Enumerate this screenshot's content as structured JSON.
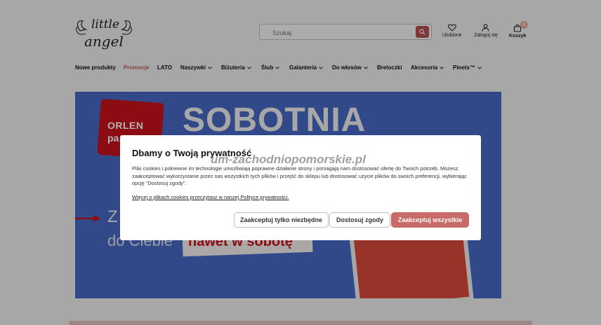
{
  "header": {
    "logo_text_top": "little",
    "logo_text_bottom": "angel",
    "search_placeholder": "Szukaj",
    "favorites_label": "Ulubione",
    "login_label": "Zaloguj się",
    "cart_label": "Koszyk",
    "cart_count": "0"
  },
  "nav": {
    "items": [
      {
        "label": "Nowe produkty"
      },
      {
        "label": "Promocje"
      },
      {
        "label": "LATO"
      },
      {
        "label": "Naszywki"
      },
      {
        "label": "Biżuteria"
      },
      {
        "label": "Ślub"
      },
      {
        "label": "Galanteria"
      },
      {
        "label": "Do włosów"
      },
      {
        "label": "Breloczki"
      },
      {
        "label": "Akcesoria"
      },
      {
        "label": "Pinets™"
      }
    ]
  },
  "banner": {
    "brand_line1": "ORLEN",
    "brand_line2": "pa",
    "headline": "SOBOTNIA",
    "side_letter": "Z",
    "line2_text": "do Ciebie",
    "highlight_text": "nawet w sobotę"
  },
  "cookie_modal": {
    "title": "Dbamy o Twoją prywatność",
    "watermark": "um-zachodniopomorskie.pl",
    "body": "Pliki cookies i pokrewne im technologie umożliwiają poprawne działanie strony i pomagają nam dostosować ofertę do Twoich potrzeb. Możesz zaakceptować wykorzystanie przez nas wszystkich tych plików i przejść do sklepu lub dostosować użycie plików do swoich preferencji, wybierając opcję \"Dostosuj zgody\".",
    "link_text": "Więcej o plikach cookies przeczytasz w naszej Polityce prywatności.",
    "btn_necessary": "Zaakceptuj tylko niezbędne",
    "btn_customize": "Dostosuj zgody",
    "btn_accept_all": "Zaakceptuj wszystkie"
  },
  "colors": {
    "accent": "#c96b69",
    "banner_blue": "#4869c4",
    "orlen_red": "#c8141c"
  }
}
